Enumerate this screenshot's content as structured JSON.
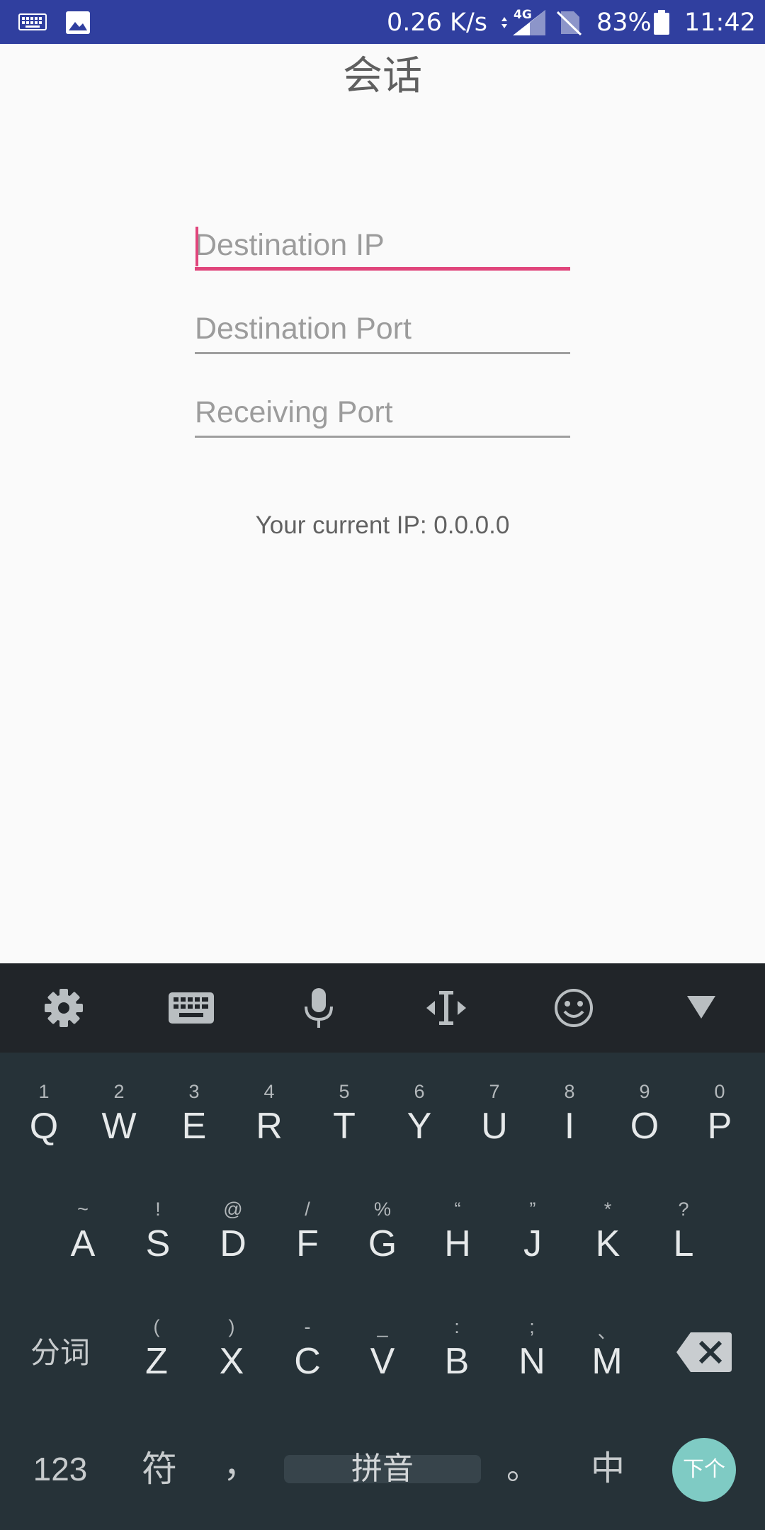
{
  "status_bar": {
    "net_speed": "0.26 K/s",
    "network_type": "4G",
    "battery": "83%",
    "time": "11:42",
    "icons": [
      "keyboard-icon",
      "image-icon",
      "data-arrows-icon",
      "signal-icon",
      "no-sim-icon",
      "battery-icon"
    ]
  },
  "app": {
    "title": "会话",
    "fields": {
      "destination_ip": {
        "placeholder": "Destination IP",
        "value": ""
      },
      "destination_port": {
        "placeholder": "Destination Port",
        "value": ""
      },
      "receiving_port": {
        "placeholder": "Receiving Port",
        "value": ""
      }
    },
    "current_ip_text": "Your current IP: 0.0.0.0",
    "accent_color": "#e0457b"
  },
  "keyboard": {
    "toolbar_icons": [
      "settings-icon",
      "keyboard-switch-icon",
      "microphone-icon",
      "cursor-move-icon",
      "emoji-icon",
      "hide-keyboard-icon"
    ],
    "row1": [
      {
        "main": "Q",
        "hint": "1"
      },
      {
        "main": "W",
        "hint": "2"
      },
      {
        "main": "E",
        "hint": "3"
      },
      {
        "main": "R",
        "hint": "4"
      },
      {
        "main": "T",
        "hint": "5"
      },
      {
        "main": "Y",
        "hint": "6"
      },
      {
        "main": "U",
        "hint": "7"
      },
      {
        "main": "I",
        "hint": "8"
      },
      {
        "main": "O",
        "hint": "9"
      },
      {
        "main": "P",
        "hint": "0"
      }
    ],
    "row2": [
      {
        "main": "A",
        "hint": "~"
      },
      {
        "main": "S",
        "hint": "!"
      },
      {
        "main": "D",
        "hint": "@"
      },
      {
        "main": "F",
        "hint": "/"
      },
      {
        "main": "G",
        "hint": "%"
      },
      {
        "main": "H",
        "hint": "“"
      },
      {
        "main": "J",
        "hint": "”"
      },
      {
        "main": "K",
        "hint": "*"
      },
      {
        "main": "L",
        "hint": "?"
      }
    ],
    "row3": [
      {
        "main": "Z",
        "hint": "("
      },
      {
        "main": "X",
        "hint": ")"
      },
      {
        "main": "C",
        "hint": "-"
      },
      {
        "main": "V",
        "hint": "_"
      },
      {
        "main": "B",
        "hint": ":"
      },
      {
        "main": "N",
        "hint": ";"
      },
      {
        "main": "M",
        "hint": "、"
      }
    ],
    "fenci_label": "分词",
    "numbers_label": "123",
    "symbols_label": "符",
    "comma_label": "，",
    "space_label": "拼音",
    "period_label": "。",
    "language_label": "中",
    "enter_label": "下个",
    "enter_color": "#7fcbc4"
  }
}
